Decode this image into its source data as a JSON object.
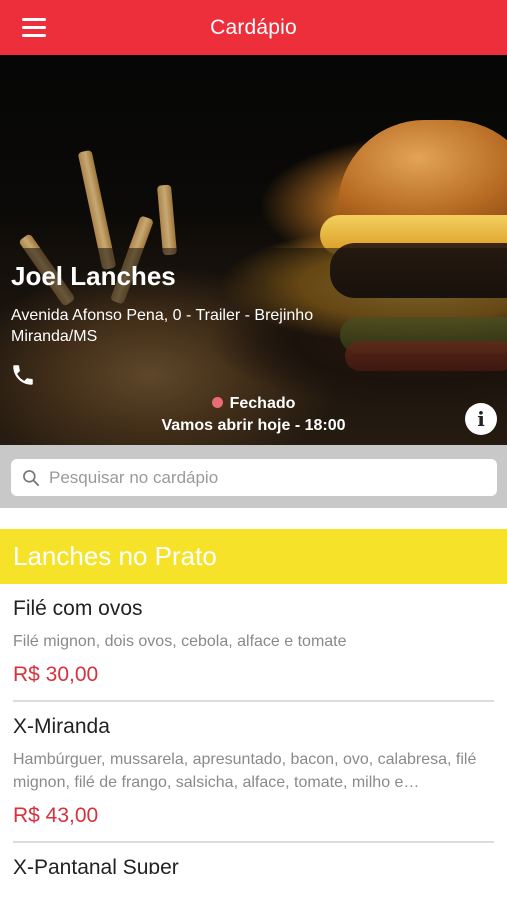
{
  "header": {
    "title": "Cardápio",
    "menu_icon": "hamburger-menu-icon"
  },
  "hero": {
    "store_name": "Joel Lanches",
    "address": "Avenida Afonso Pena, 0 - Trailer - Brejinho Miranda/MS",
    "phone_icon": "phone-icon",
    "status": "Fechado",
    "status_color": "#e96b74",
    "opening": "Vamos abrir hoje - 18:00",
    "info_icon": "info-icon"
  },
  "search": {
    "placeholder": "Pesquisar no cardápio",
    "icon": "search-icon"
  },
  "category": {
    "title": "Lanches no Prato",
    "color": "#f7e22a"
  },
  "items": [
    {
      "name": "Filé com ovos",
      "description": "Filé mignon, dois ovos, cebola, alface e tomate",
      "price": "R$ 30,00"
    },
    {
      "name": "X-Miranda",
      "description": "Hambúrguer, mussarela, apresuntado, bacon, ovo, calabresa, filé mignon, filé de frango, salsicha, alface, tomate, milho e…",
      "price": "R$ 43,00"
    },
    {
      "name": "X-Pantanal Super",
      "description": "",
      "price": ""
    }
  ],
  "colors": {
    "brand": "#ec2f3a",
    "price": "#d7323b"
  }
}
